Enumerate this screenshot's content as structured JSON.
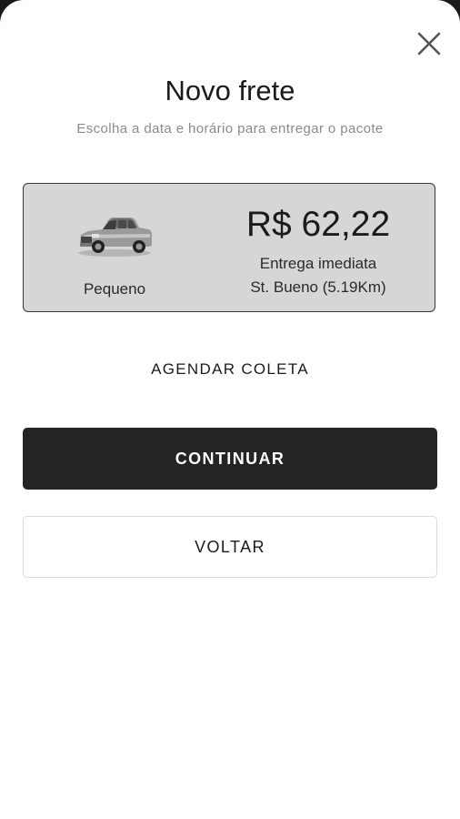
{
  "modal": {
    "title": "Novo frete",
    "subtitle": "Escolha a data e horário para entregar o pacote"
  },
  "freight_option": {
    "vehicle_icon": "pickup-truck-icon",
    "vehicle_size": "Pequeno",
    "price": "R$ 62,22",
    "delivery_type": "Entrega imediata",
    "destination": "St. Bueno (5.19Km)"
  },
  "actions": {
    "schedule_label": "AGENDAR COLETA",
    "continue_label": "CONTINUAR",
    "back_label": "VOLTAR"
  },
  "colors": {
    "primary_button": "#242424",
    "card_background": "#d6d6d6"
  }
}
